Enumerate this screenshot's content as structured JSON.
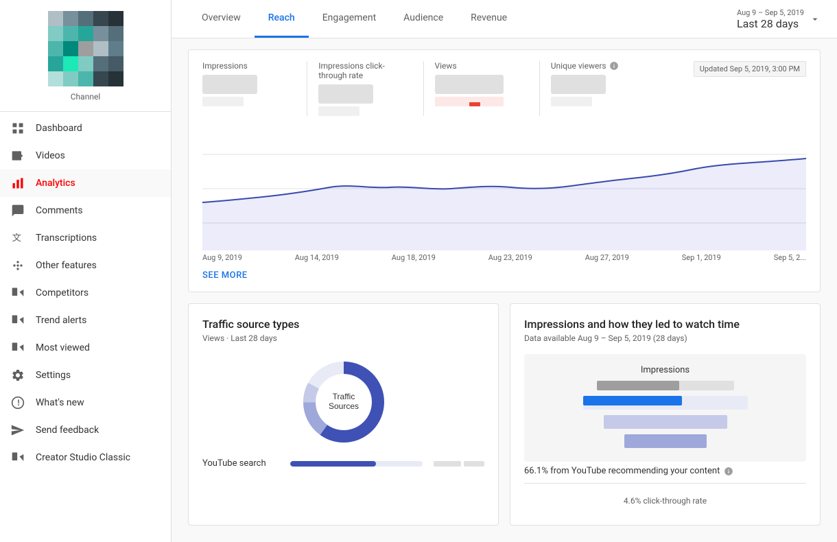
{
  "sidebar": {
    "channel_label": "Channel",
    "items": [
      {
        "id": "dashboard",
        "label": "Dashboard",
        "icon": "dashboard-icon"
      },
      {
        "id": "videos",
        "label": "Videos",
        "icon": "videos-icon"
      },
      {
        "id": "analytics",
        "label": "Analytics",
        "icon": "analytics-icon",
        "active": true
      },
      {
        "id": "comments",
        "label": "Comments",
        "icon": "comments-icon"
      },
      {
        "id": "transcriptions",
        "label": "Transcriptions",
        "icon": "transcriptions-icon"
      },
      {
        "id": "other-features",
        "label": "Other features",
        "icon": "other-features-icon"
      },
      {
        "id": "competitors",
        "label": "Competitors",
        "icon": "competitors-icon"
      },
      {
        "id": "trend-alerts",
        "label": "Trend alerts",
        "icon": "trend-alerts-icon"
      },
      {
        "id": "most-viewed",
        "label": "Most viewed",
        "icon": "most-viewed-icon"
      },
      {
        "id": "settings",
        "label": "Settings",
        "icon": "settings-icon"
      },
      {
        "id": "whats-new",
        "label": "What's new",
        "icon": "whats-new-icon"
      },
      {
        "id": "send-feedback",
        "label": "Send feedback",
        "icon": "send-feedback-icon"
      },
      {
        "id": "creator-studio",
        "label": "Creator Studio Classic",
        "icon": "creator-studio-icon"
      }
    ]
  },
  "header": {
    "date_range_sub": "Aug 9 – Sep 5, 2019",
    "date_range_main": "Last 28 days",
    "tabs": [
      {
        "id": "overview",
        "label": "Overview"
      },
      {
        "id": "reach",
        "label": "Reach",
        "active": true
      },
      {
        "id": "engagement",
        "label": "Engagement"
      },
      {
        "id": "audience",
        "label": "Audience"
      },
      {
        "id": "revenue",
        "label": "Revenue"
      }
    ]
  },
  "stats": {
    "updated_label": "Updated Sep 5, 2019, 3:00 PM",
    "items": [
      {
        "id": "impressions",
        "label": "Impressions"
      },
      {
        "id": "impressions-ctr",
        "label": "Impressions click-through rate"
      },
      {
        "id": "views",
        "label": "Views"
      },
      {
        "id": "unique-viewers",
        "label": "Unique viewers"
      }
    ]
  },
  "chart": {
    "x_labels": [
      "Aug 9, 2019",
      "Aug 14, 2019",
      "Aug 18, 2019",
      "Aug 23, 2019",
      "Aug 27, 2019",
      "Sep 1, 2019",
      "Sep 5, 2..."
    ],
    "see_more": "SEE MORE"
  },
  "traffic_sources": {
    "title": "Traffic source types",
    "subtitle": "Views · Last 28 days",
    "donut_center_label": "Traffic\nSources",
    "items": [
      {
        "label": "YouTube search",
        "bar_width": "65"
      }
    ]
  },
  "impressions_funnel": {
    "title": "Impressions and how they led to watch time",
    "subtitle": "Data available Aug 9 – Sep 5, 2019 (28 days)",
    "funnel_title": "Impressions",
    "stat1": "66.1% from YouTube recommending your content",
    "stat2": "4.6% click-through rate"
  }
}
